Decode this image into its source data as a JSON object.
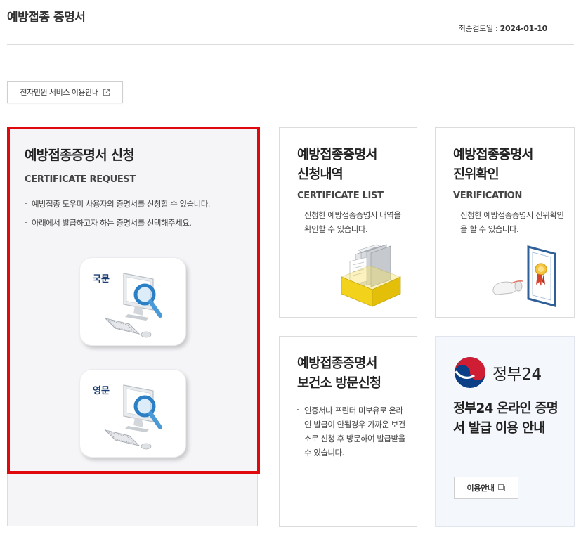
{
  "header": {
    "title": "예방접종 증명서",
    "review_label": "최종검토일 : ",
    "review_date": "2024-01-10"
  },
  "guide_button": {
    "label": "전자민원 서비스 이용안내",
    "icon": "external-link-icon"
  },
  "request_card": {
    "title": "예방접종증명서 신청",
    "subtitle": "CERTIFICATE REQUEST",
    "bullets": [
      "예방접종 도우미 사용자의 증명서를 신청할 수 있습니다.",
      "아래에서 발급하고자 하는 증명서를 선택해주세요."
    ],
    "korean_button": {
      "label": "국문",
      "icon": "computer-magnifier-icon"
    },
    "english_button": {
      "label": "영문",
      "icon": "computer-magnifier-icon"
    },
    "highlight_color": "#e0080b"
  },
  "list_card": {
    "title_line1": "예방접종증명서",
    "title_line2": "신청내역",
    "subtitle": "CERTIFICATE LIST",
    "bullets": [
      "신청한 예방접종증명서 내역을 확인할 수 있습니다."
    ],
    "icon": "document-box-icon"
  },
  "verify_card": {
    "title_line1": "예방접종증명서",
    "title_line2": "진위확인",
    "subtitle": "VERIFICATION",
    "bullets": [
      "신청한 예방접종증명서 진위확인을 할 수 있습니다."
    ],
    "icon": "certificate-icon"
  },
  "visit_card": {
    "title_line1": "예방접종증명서",
    "title_line2": "보건소 방문신청",
    "bullets": [
      "인증서나 프린터 미보유로 온라인 발급이 안될경우 가까운 보건소로 신청 후 방문하여 발급받을 수 있습니다."
    ]
  },
  "gov_card": {
    "logo_text": "정부24",
    "logo_icon": "taegeuk-icon",
    "title": "정부24 온라인 증명서 발급 이용 안내",
    "button_label": "이용안내",
    "button_icon": "new-window-icon"
  }
}
